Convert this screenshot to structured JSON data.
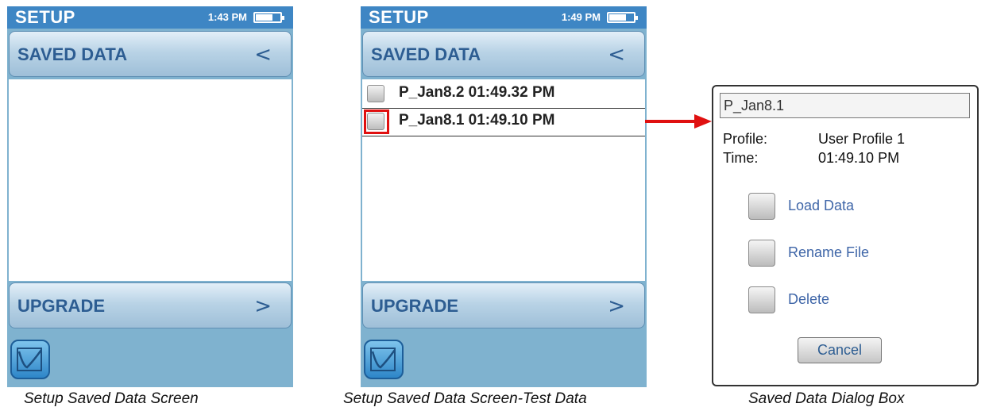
{
  "screen1": {
    "status": {
      "title": "SETUP",
      "time": "1:43 PM"
    },
    "saved_data_label": "SAVED DATA",
    "saved_data_chevron": "<",
    "upgrade_label": "UPGRADE",
    "upgrade_chevron": ">",
    "bottom_icon": "graph-icon",
    "caption": "Setup Saved Data Screen"
  },
  "screen2": {
    "status": {
      "title": "SETUP",
      "time": "1:49 PM"
    },
    "saved_data_label": "SAVED DATA",
    "saved_data_chevron": "<",
    "files": [
      {
        "label": "P_Jan8.2 01:49.32 PM"
      },
      {
        "label": "P_Jan8.1 01:49.10 PM",
        "highlighted": true
      }
    ],
    "upgrade_label": "UPGRADE",
    "upgrade_chevron": ">",
    "bottom_icon": "graph-icon",
    "caption": "Setup Saved Data Screen-Test Data"
  },
  "dialog": {
    "file_name": "P_Jan8.1",
    "profile_label": "Profile:",
    "profile_value": "User Profile 1",
    "time_label": "Time:",
    "time_value": "01:49.10 PM",
    "options": [
      "Load Data",
      "Rename File",
      "Delete"
    ],
    "cancel_label": "Cancel",
    "caption": "Saved Data Dialog Box"
  },
  "colors": {
    "status_bar": "#3e86c4",
    "screen_bg": "#7fb2cf",
    "button_text": "#2d5d92",
    "highlight": "#e01010",
    "arrow": "#e01010"
  }
}
